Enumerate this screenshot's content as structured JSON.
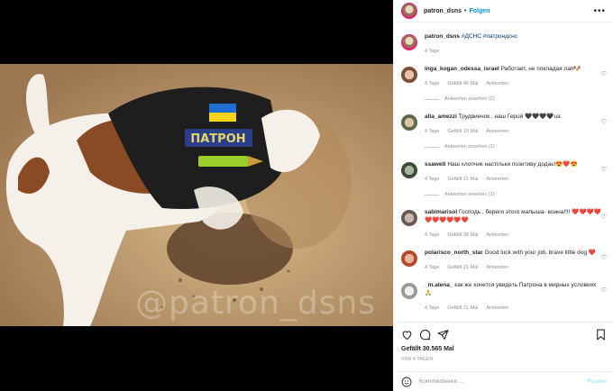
{
  "post": {
    "author": "patron_dsns",
    "follow_label": "Folgen",
    "dot": "•",
    "more_label": "•••",
    "watermark": "@patron_dsns",
    "patch_text": "ПАТРОН",
    "caption_author": "patron_dsns",
    "caption_text": "#ДСНС #патрондснс",
    "caption_age": "4 Tage",
    "likes": "Gefällt 30.565 Mal",
    "age": "VOR 4 TAGEN",
    "comment_placeholder": "Kommentieren ...",
    "post_button": "Posten"
  },
  "comments": [
    {
      "user": "inga_kogan_odessa_israel",
      "text": "Работает, не покладая лап🐶",
      "age": "4 Tage",
      "likes": "Gefällt 46 Mal",
      "reply": "Antworten",
      "replies": "Antworten ansehen (2)"
    },
    {
      "user": "alla_amezzi",
      "text": "Трудвинчок , наш Герой 🖤🖤🖤🖤ua",
      "age": "4 Tage",
      "likes": "Gefällt 19 Mal",
      "reply": "Antworten",
      "replies": "Antworten ansehen (1)"
    },
    {
      "user": "ssaweti",
      "text": "Наш хлопчик настільки позитиву додає!😍❤️😍",
      "age": "4 Tage",
      "likes": "Gefällt 21 Mal",
      "reply": "Antworten",
      "replies": "Antworten ansehen (1)"
    },
    {
      "user": "sabimarisol",
      "text": "Господь , береги этого малыша- воина!!!! ❤️❤️❤️❤️❤️❤️❤️❤️❤️❤️",
      "age": "4 Tage",
      "likes": "Gefällt 28 Mal",
      "reply": "Antworten",
      "replies": ""
    },
    {
      "user": "polarisco_north_star",
      "text": "Good luck with your job, brave little dog ❤️",
      "age": "4 Tage",
      "likes": "Gefällt 21 Mal",
      "reply": "Antworten",
      "replies": ""
    },
    {
      "user": "_m.alena_",
      "text": "как же хочется увидеть Патрона в мирных условиях🙏",
      "age": "4 Tage",
      "likes": "Gefällt 21 Mal",
      "reply": "Antworten",
      "replies": ""
    }
  ]
}
